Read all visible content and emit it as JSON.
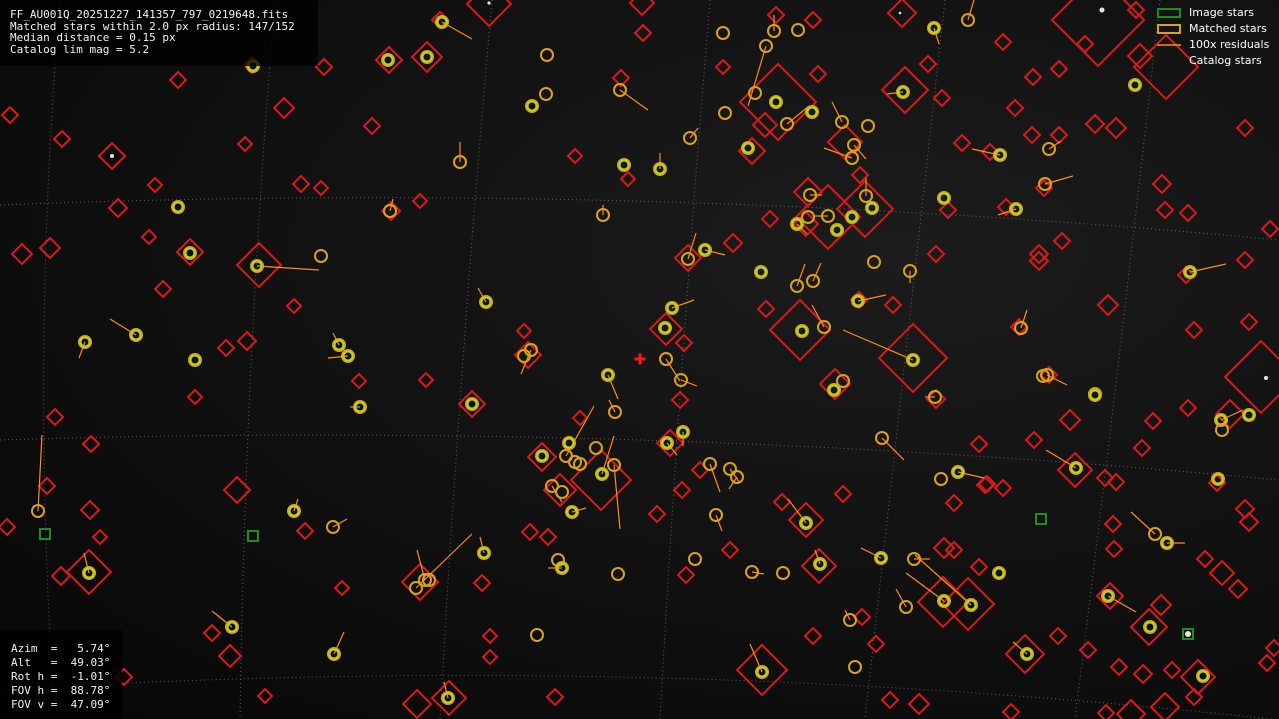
{
  "header_info": {
    "filename": "FF_AU001Q_20251227_141357_797_0219648.fits",
    "matched": "Matched stars within 2.0 px radius: 147/152",
    "median": "Median distance = 0.15 px",
    "catalog": "Catalog lim mag = 5.2"
  },
  "legend": {
    "image_stars": "Image stars",
    "matched_stars": "Matched stars",
    "residuals": "100x residuals",
    "catalog_stars": "Catalog stars"
  },
  "params": {
    "azim": "Azim  =   5.74°",
    "alt": "Alt   =  49.03°",
    "roth": "Rot h =  -1.01°",
    "fovh": "FOV h =  88.78°",
    "fovv": "FOV v =  47.09°"
  },
  "colors": {
    "catalog_star": "#d91a1a",
    "image_star": "#1f8c1f",
    "matched_star": "#d9a11f",
    "residual": "#ff8c1a",
    "detected_star": "#b9d624",
    "center_marker": "#ff1a1a",
    "grid": "#8c8c8c"
  },
  "icons": {
    "center": "center-cross-icon",
    "legend_image": "green-square-icon",
    "legend_matched": "yellow-square-icon",
    "legend_residual": "orange-line-icon"
  }
}
